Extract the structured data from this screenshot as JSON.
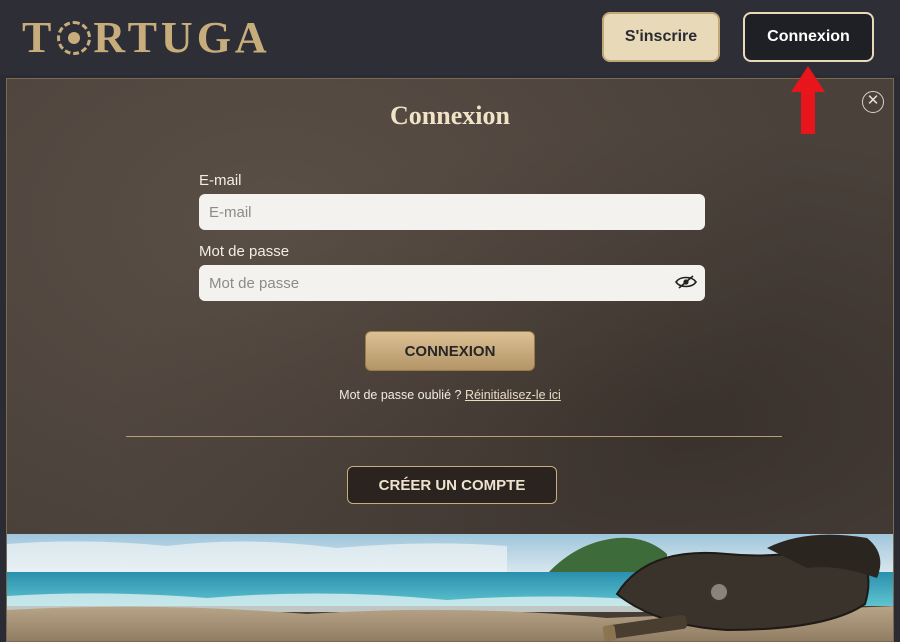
{
  "header": {
    "logo_text_left": "T",
    "logo_text_right": "RTUGA",
    "signup_label": "S'inscrire",
    "login_label": "Connexion"
  },
  "modal": {
    "title": "Connexion",
    "email": {
      "label": "E-mail",
      "placeholder": "E-mail",
      "value": ""
    },
    "password": {
      "label": "Mot de passe",
      "placeholder": "Mot de passe",
      "value": ""
    },
    "submit_label": "CONNEXION",
    "forgot_text": "Mot de passe oublié ?",
    "reset_link": "Réinitialisez-le ici",
    "create_account_label": "CRÉER UN COMPTE"
  },
  "colors": {
    "header_bg": "#2d2e36",
    "gold": "#c8ad7c",
    "signup_bg": "#e8d9b8",
    "arrow": "#e8161c"
  },
  "icons": [
    "pirate-chip-logo-icon",
    "close-icon",
    "eye-slash-icon",
    "red-arrow-annotation"
  ]
}
